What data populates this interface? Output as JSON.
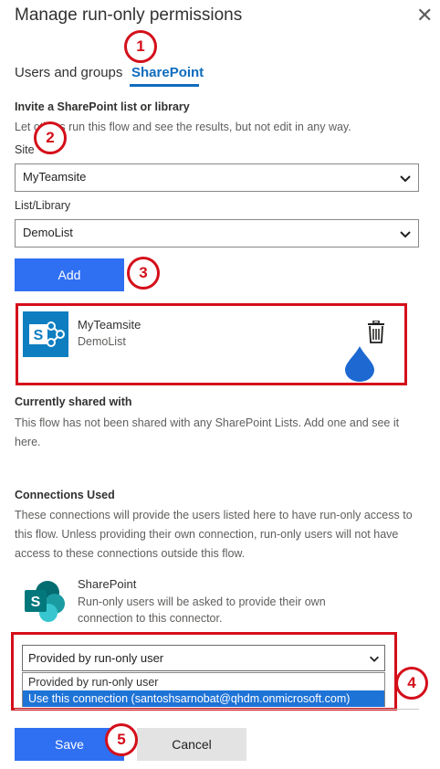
{
  "panel": {
    "title": "Manage run-only permissions",
    "close_glyph": "✕"
  },
  "tabs": [
    {
      "label": "Users and groups",
      "active": false
    },
    {
      "label": "SharePoint",
      "active": true
    }
  ],
  "invite": {
    "heading": "Invite a SharePoint list or library",
    "description": "Let others run this flow and see the results, but not edit in any way.",
    "site_label": "Site",
    "site_value": "MyTeamsite",
    "list_label": "List/Library",
    "list_value": "DemoList",
    "add_label": "Add"
  },
  "shared_item": {
    "title": "MyTeamsite",
    "subtitle": "DemoList",
    "delete_icon": "trash-icon"
  },
  "currently_shared": {
    "heading": "Currently shared with",
    "text": "This flow has not been shared with any SharePoint Lists. Add one and see it here."
  },
  "connections": {
    "heading": "Connections Used",
    "text": "These connections will provide the users listed here to have run-only access to this flow. Unless providing their own connection, run-only users will not have access to these connections outside this flow.",
    "connector_name": "SharePoint",
    "connector_desc": "Run-only users will be asked to provide their own connection to this connector.",
    "select_value": "Provided by run-only user",
    "options": [
      "Provided by run-only user",
      "Use this connection (santoshsarnobat@qhdm.onmicrosoft.com)"
    ]
  },
  "footer": {
    "save_label": "Save",
    "cancel_label": "Cancel"
  },
  "annotations": [
    "1",
    "2",
    "3",
    "4",
    "5"
  ],
  "colors": {
    "accent": "#0f6cbd",
    "primary_button": "#2f6ff2",
    "annotation_red": "#d40f1a",
    "sharepoint_teal": "#036c70"
  }
}
